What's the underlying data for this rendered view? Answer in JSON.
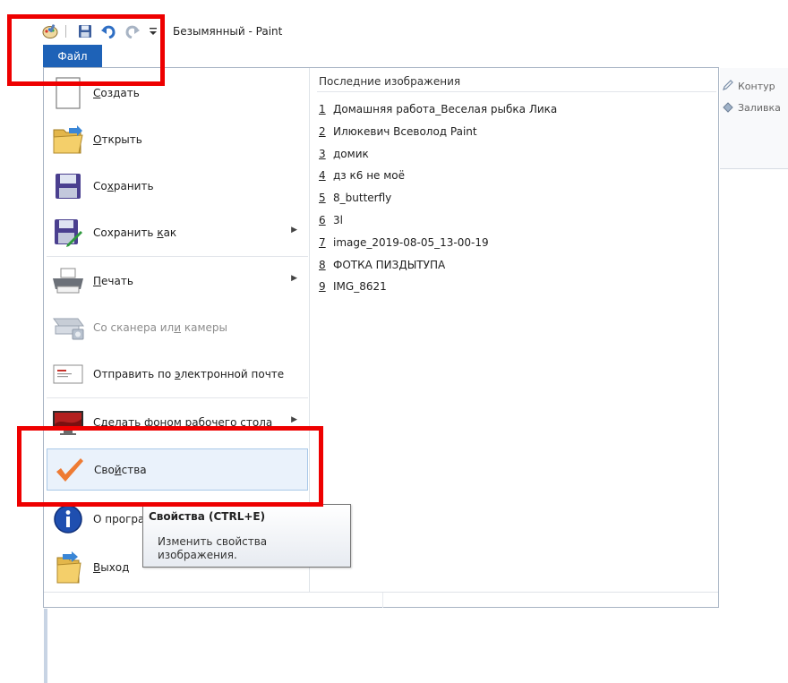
{
  "window": {
    "title": "Безымянный - Paint"
  },
  "file_tab": {
    "label": "Файл"
  },
  "ribbon": {
    "outline_label": "Контур",
    "fill_label": "Заливка"
  },
  "menu": {
    "items": [
      {
        "pre": "",
        "key": "С",
        "post": "оздать"
      },
      {
        "pre": "",
        "key": "О",
        "post": "ткрыть"
      },
      {
        "pre": "Со",
        "key": "х",
        "post": "ранить"
      },
      {
        "pre": "Сохранить ",
        "key": "к",
        "post": "ак"
      },
      {
        "pre": "",
        "key": "П",
        "post": "ечать"
      },
      {
        "pre": "Со сканера ил",
        "key": "и",
        "post": " камеры"
      },
      {
        "pre": "Отправить по ",
        "key": "э",
        "post": "лектронной почте"
      },
      {
        "pre": "Сделать фоном рабочего стола",
        "key": "",
        "post": ""
      },
      {
        "pre": "Сво",
        "key": "й",
        "post": "ства"
      },
      {
        "pre": "О програ",
        "key": "",
        "post": ""
      },
      {
        "pre": "",
        "key": "В",
        "post": "ыход"
      }
    ]
  },
  "recent": {
    "heading": "Последние изображения",
    "items": [
      {
        "num": "1",
        "name": "Домашняя работа_Веселая рыбка Лика"
      },
      {
        "num": "2",
        "name": "Илюкевич Всеволод Paint"
      },
      {
        "num": "3",
        "name": "домик"
      },
      {
        "num": "4",
        "name": "дз к6 не моё"
      },
      {
        "num": "5",
        "name": "8_butterfly"
      },
      {
        "num": "6",
        "name": "3l"
      },
      {
        "num": "7",
        "name": "image_2019-08-05_13-00-19"
      },
      {
        "num": "8",
        "name": "ФОТКА ПИЗДЫТУПА"
      },
      {
        "num": "9",
        "name": "IMG_8621"
      }
    ]
  },
  "tooltip": {
    "title": "Свойства (CTRL+E)",
    "body": "Изменить свойства изображения."
  },
  "colors": {
    "accent": "#1e62b7",
    "annotation": "#ee0000",
    "selected_bg": "#eaf2fb"
  }
}
